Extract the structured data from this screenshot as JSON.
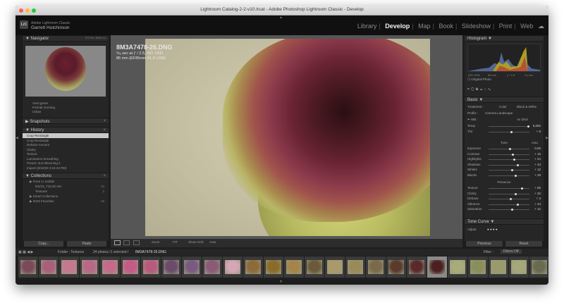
{
  "window": {
    "title": "Lightroom Catalog-2-2-v10.lrcat - Adobe Photoshop Lightroom Classic - Develop"
  },
  "identity": {
    "line1": "Adobe Lightroom Classic",
    "line2": "Garrett Hutchinson",
    "badge": "LrC"
  },
  "modules": [
    "Library",
    "Develop",
    "Map",
    "Book",
    "Slideshow",
    "Print",
    "Web"
  ],
  "active_module": "Develop",
  "left_panel": {
    "navigator": {
      "title": "Navigator",
      "zoom": [
        "FIT",
        "FILL",
        "100%",
        "1:1"
      ]
    },
    "presets_tail": [
      "Vivid green",
      "Portrait morning",
      "Urban"
    ],
    "snapshots_title": "Snapshots",
    "history": {
      "title": "History",
      "items": [
        {
          "label": "Crop Rectangle",
          "sel": true
        },
        {
          "label": "Crop Rectangle"
        },
        {
          "label": "Dehaze Amount"
        },
        {
          "label": "Clarity"
        },
        {
          "label": "Texture"
        },
        {
          "label": "Luminance Smoothing"
        },
        {
          "label": "Preset: 2LD Blooming 2"
        },
        {
          "label": "Import (3/10/20 2:15:10 PM)"
        }
      ]
    },
    "collections": {
      "title": "Collections",
      "items": [
        {
          "label": "From Lr mobile"
        },
        {
          "label": "5/2/19_T16:32 AM",
          "count": "33"
        },
        {
          "label": "Textures",
          "count": "2"
        },
        {
          "label": "Smart Collections"
        },
        {
          "label": "2019 Favorites",
          "count": "29"
        }
      ]
    },
    "copy_button": "Copy...",
    "paste_button": "Paste"
  },
  "photo_info": {
    "filename": "8M3A7478-26.DNG",
    "line1": "⅓₀ sec at ƒ / 2.5, ISO 1000",
    "line2": "85 mm (EF85mm f/1.8 USM)"
  },
  "toolbar": {
    "zoom_label": "Zoom",
    "zoom_value": "FIT",
    "show_grid": "Show Grid:",
    "auto": "Auto"
  },
  "right_panel": {
    "histogram_title": "Histogram",
    "histogram_values": [
      "ISO 1000",
      "85 mm",
      "ƒ / 2.5",
      "⅓₀ sec"
    ],
    "original_photo": "Original Photo",
    "basic_title": "Basic",
    "treatment_label": "Treatment :",
    "treatment_color": "Color",
    "treatment_bw": "Black & White",
    "profile_label": "Profile :",
    "profile_value": "Camera Landscape",
    "wb_label": "WB :",
    "wb_value": "As Shot",
    "tone_title": "Tone",
    "tone_auto": "Auto",
    "presence_title": "Presence",
    "sliders_wb": [
      {
        "label": "Temp",
        "value": "5,050"
      },
      {
        "label": "Tint",
        "value": "+ 8"
      }
    ],
    "sliders_tone": [
      {
        "label": "Exposure",
        "value": "0.00"
      },
      {
        "label": "Contrast",
        "value": "+ 16"
      },
      {
        "label": "Highlights",
        "value": "+ 24"
      },
      {
        "label": "Shadows",
        "value": "+ 43"
      },
      {
        "label": "Whites",
        "value": "+ 12"
      },
      {
        "label": "Blacks",
        "value": "+ 29"
      }
    ],
    "sliders_presence": [
      {
        "label": "Texture",
        "value": "+ 66"
      },
      {
        "label": "Clarity",
        "value": "+ 32"
      },
      {
        "label": "Dehaze",
        "value": "+ 3"
      },
      {
        "label": "Vibrance",
        "value": "+ 43"
      },
      {
        "label": "Saturation",
        "value": "+ 12"
      }
    ],
    "tone_curve_title": "Tone Curve",
    "adjust_label": "Adjust",
    "previous_button": "Previous",
    "reset_button": "Reset"
  },
  "filmstrip": {
    "folder_text": "Folder : Textures",
    "count_text": "24 photos /1 selected /",
    "selected_file": "8M3A7478-26.DNG",
    "filter_label": "Filter :",
    "filter_value": "Filters Off",
    "thumb_colors": [
      "#7a4a5a",
      "#a8607a",
      "#c47890",
      "#b76886",
      "#c46a8a",
      "#c45a86",
      "#b85a7e",
      "#6b4a6a",
      "#7a5a80",
      "#8a5a76",
      "#d4a6b6",
      "#8c6a3a",
      "#8a6b2a",
      "#a4844a",
      "#6a5a3a",
      "#aa9a6a",
      "#9a8a5a",
      "#7a6a4a",
      "#5a3a2a",
      "#5a2a2a",
      "#4a2020",
      "#a8ac7a",
      "#8a8e5a",
      "#9a9a6a",
      "#a6a87a",
      "#6a6a50"
    ],
    "selected_index": 20
  },
  "colors": {
    "bg": "#1d1d1d",
    "panel": "#262626",
    "active_text": "#f2f2f2"
  }
}
